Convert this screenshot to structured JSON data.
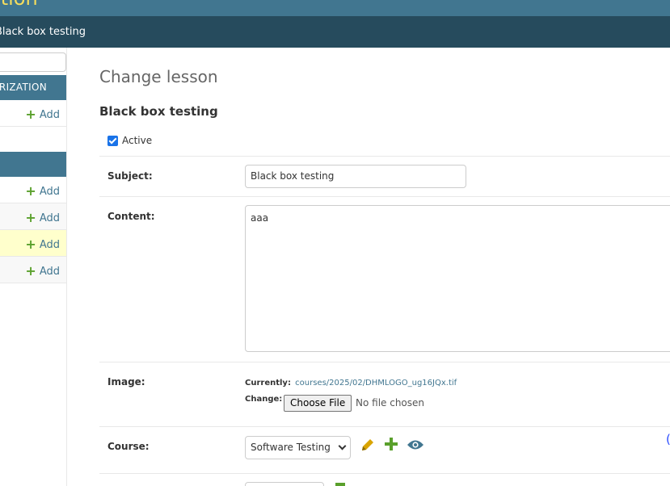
{
  "header": {
    "brand_partial": "ation",
    "breadcrumb_partial": "Black box testing"
  },
  "sidebar": {
    "modules": [
      {
        "caption_partial": "ORIZATION",
        "rows": [
          {
            "add_label": "Add"
          }
        ]
      },
      {
        "caption_partial": "",
        "rows": [
          {
            "add_label": "Add"
          },
          {
            "add_label": "Add"
          },
          {
            "add_label": "Add",
            "highlighted": true
          },
          {
            "add_label": "Add"
          }
        ]
      }
    ]
  },
  "main": {
    "page_title": "Change lesson",
    "object_title": "Black box testing",
    "active": {
      "label": "Active",
      "checked": true
    },
    "subject": {
      "label": "Subject:",
      "value": "Black box testing"
    },
    "content": {
      "label": "Content:",
      "value": "aaa"
    },
    "image": {
      "label": "Image:",
      "currently_label": "Currently:",
      "currently_value": "courses/2025/02/DHMLOGO_ug16JQx.tif",
      "change_label": "Change:",
      "choose_button": "Choose File",
      "no_file": "No file chosen"
    },
    "course": {
      "label": "Course:",
      "selected": "Software Testing"
    },
    "edge_mark": "("
  },
  "colors": {
    "primary": "#417690",
    "breadcrumbs": "#264b5d",
    "brand": "#f5dd5d",
    "add_green": "#5aa02c",
    "highlight": "#ffffcc",
    "pencil": "#d9a400",
    "eye": "#417690"
  }
}
